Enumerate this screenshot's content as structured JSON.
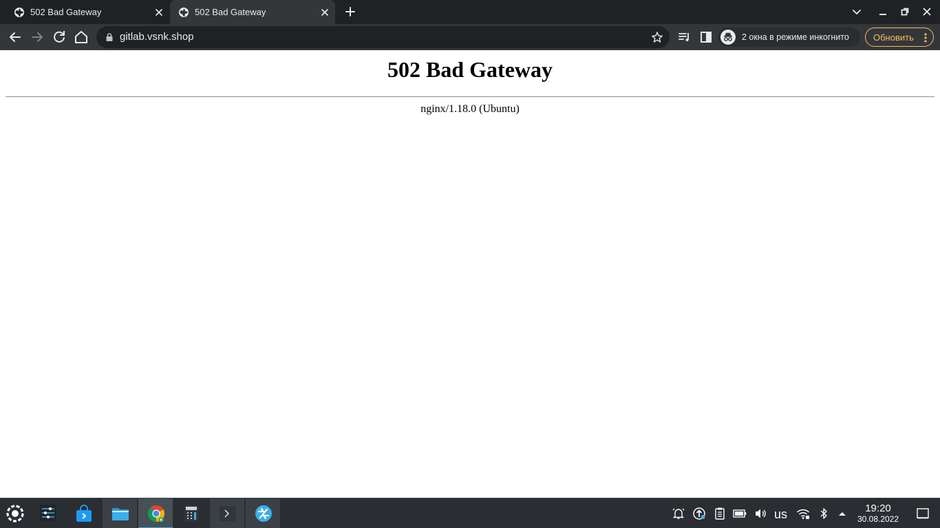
{
  "browser": {
    "tabs": [
      {
        "title": "502 Bad Gateway",
        "active": false
      },
      {
        "title": "502 Bad Gateway",
        "active": true
      }
    ],
    "address_bar": {
      "url": "gitlab.vsnk.shop"
    },
    "incognito_label": "2 окна в режиме инкогнито",
    "update_label": "Обновить",
    "accent_color": "#f0c05a"
  },
  "page": {
    "heading": "502 Bad Gateway",
    "server": "nginx/1.18.0 (Ubuntu)"
  },
  "taskbar": {
    "apps": [
      {
        "name": "application-launcher-icon"
      },
      {
        "name": "system-settings-icon"
      },
      {
        "name": "discover-store-icon"
      },
      {
        "name": "file-manager-icon"
      },
      {
        "name": "chrome-icon"
      },
      {
        "name": "calculator-icon"
      },
      {
        "name": "terminal-icon"
      },
      {
        "name": "remmina-icon"
      }
    ],
    "keyboard_layout": "us",
    "clock": {
      "time": "19:20",
      "date": "30.08.2022"
    }
  }
}
